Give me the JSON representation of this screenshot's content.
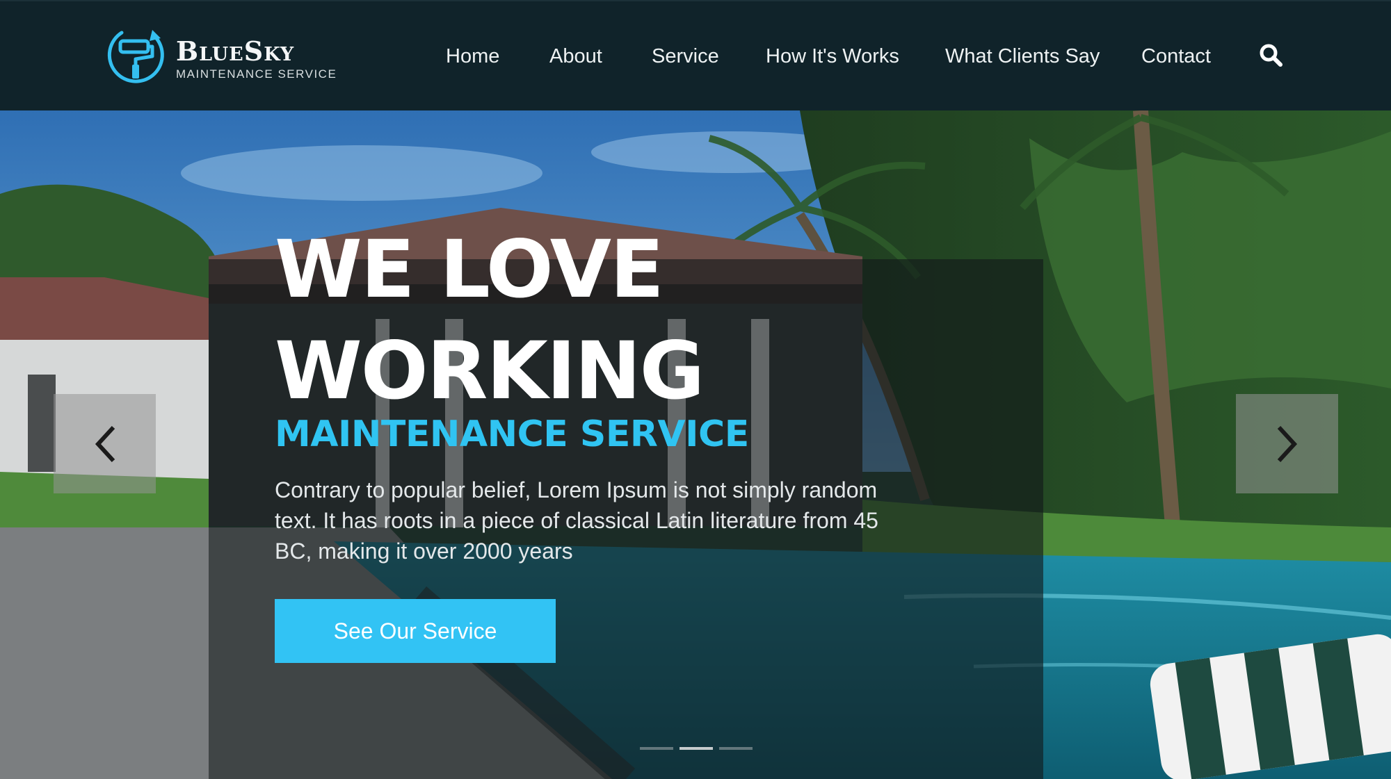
{
  "brand": {
    "name": "BlueSky",
    "tagline": "MAINTENANCE SERVICE",
    "accent_color": "#30c4f2",
    "logo_icon": "paint-roller-icon"
  },
  "nav": {
    "items": [
      "Home",
      "About",
      "Service",
      "How It's Works",
      "What Clients Say",
      "Contact"
    ],
    "search_icon": "search-icon"
  },
  "hero": {
    "headline_line1": "WE LOVE",
    "headline_line2": "WORKING",
    "subheadline": "MAINTENANCE SERVICE",
    "body": "Contrary to popular belief, Lorem Ipsum is not simply random text. It has roots in a piece of classical Latin literature from 45 BC, making it over 2000 years",
    "cta_label": "See Our Service",
    "prev_icon": "chevron-left-icon",
    "next_icon": "chevron-right-icon",
    "slide_count": 3,
    "active_slide": 2
  }
}
